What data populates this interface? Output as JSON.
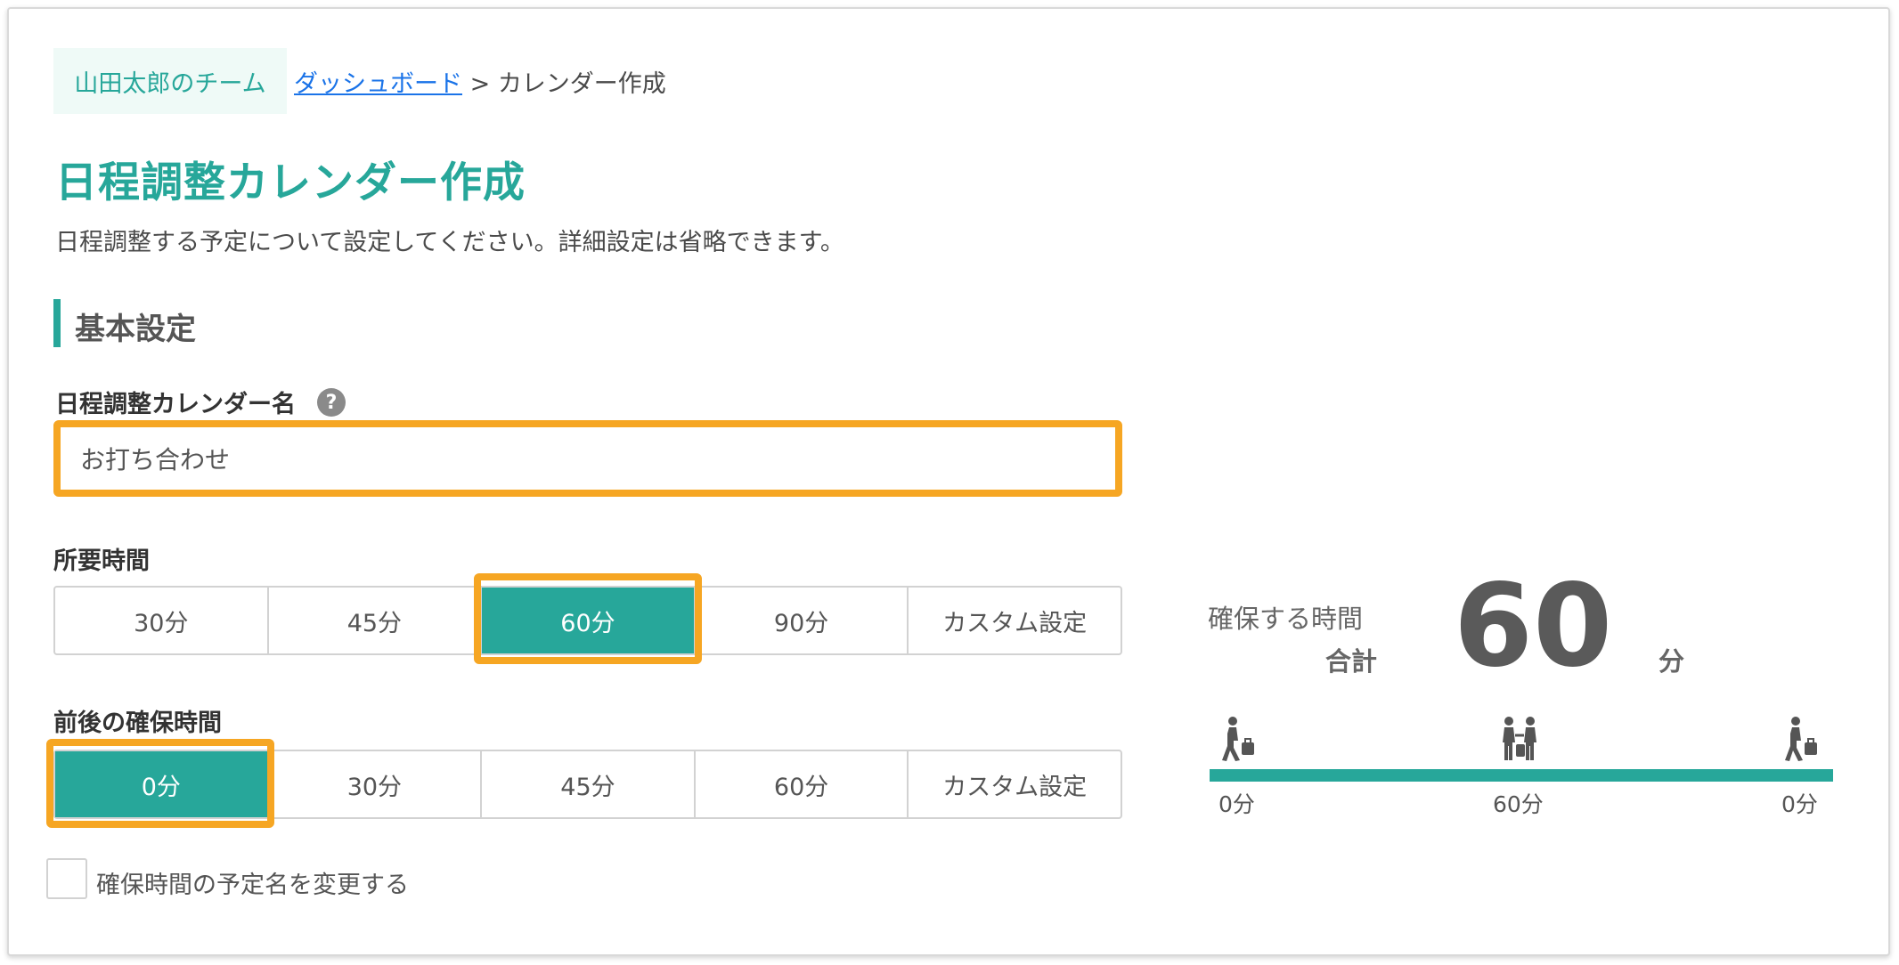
{
  "breadcrumb": {
    "team": "山田太郎のチーム",
    "dashboard_link": "ダッシュボード",
    "separator": ">",
    "current": "カレンダー作成"
  },
  "page": {
    "title": "日程調整カレンダー作成",
    "description": "日程調整する予定について設定してください。詳細設定は省略できます。"
  },
  "basic_settings": {
    "section_title": "基本設定",
    "name_label": "日程調整カレンダー名",
    "help_icon": "?",
    "name_value": "お打ち合わせ",
    "duration_label": "所要時間",
    "duration_options": [
      "30分",
      "45分",
      "60分",
      "90分",
      "カスタム設定"
    ],
    "duration_selected": "60分",
    "buffer_label": "前後の確保時間",
    "buffer_options": [
      "0分",
      "30分",
      "45分",
      "60分",
      "カスタム設定"
    ],
    "buffer_selected": "0分",
    "rename_checkbox_label": "確保時間の予定名を変更する",
    "rename_checkbox_checked": false
  },
  "summary": {
    "label_line1": "確保する時間",
    "label_line2": "合計",
    "value": "60",
    "unit": "分",
    "timeline": {
      "start_label": "0分",
      "middle_label": "60分",
      "end_label": "0分",
      "start_icon": "person-walking-with-luggage-icon",
      "middle_icon": "people-meeting-icon",
      "end_icon": "person-walking-with-luggage-icon"
    }
  },
  "colors": {
    "accent": "#27a79a",
    "highlight": "#f6a623",
    "link": "#1a73e8"
  }
}
